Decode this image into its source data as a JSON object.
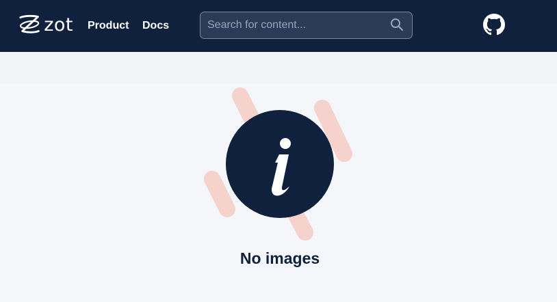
{
  "header": {
    "logo_text": "zot",
    "nav": [
      {
        "label": "Product"
      },
      {
        "label": "Docs"
      }
    ],
    "search": {
      "placeholder": "Search for content...",
      "value": ""
    }
  },
  "main": {
    "empty_state_title": "No images"
  },
  "colors": {
    "navbar_bg": "#0f213d",
    "page_bg": "#f5f6f9",
    "accent_circle": "#0f213d",
    "decor_pink": "#f5d3cc"
  },
  "icons": [
    "zot-logo-icon",
    "search-icon",
    "github-icon",
    "info-icon"
  ]
}
